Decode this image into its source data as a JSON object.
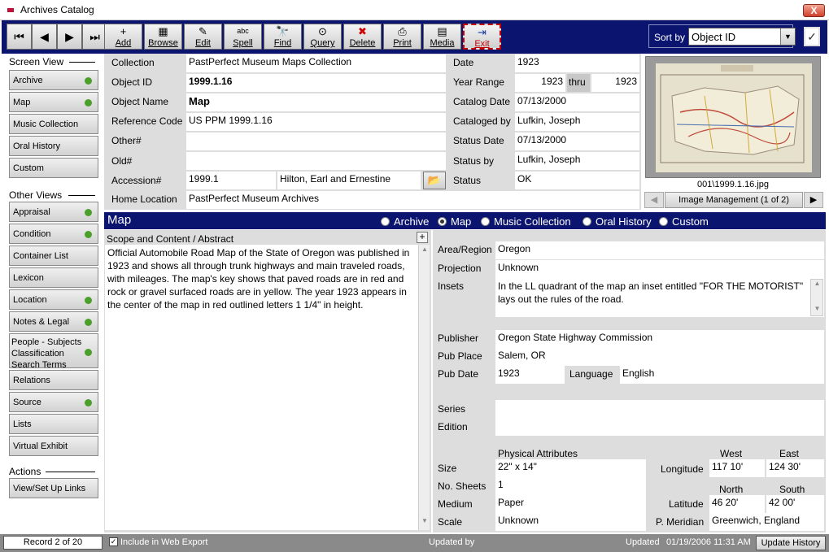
{
  "window": {
    "title": "Archives Catalog",
    "close_glyph": "X"
  },
  "toolbar": {
    "nav": [
      "⏮",
      "◀",
      "▶",
      "⏭"
    ],
    "buttons": [
      {
        "label": "Add",
        "icon": "+"
      },
      {
        "label": "Browse",
        "icon": "▦"
      },
      {
        "label": "Edit",
        "icon": "✎"
      },
      {
        "label": "Spell",
        "icon": "abc"
      },
      {
        "label": "Find",
        "icon": "🔭"
      },
      {
        "label": "Query",
        "icon": "⊙"
      },
      {
        "label": "Delete",
        "icon": "✖"
      },
      {
        "label": "Print",
        "icon": "⎙"
      },
      {
        "label": "Media",
        "icon": "▤"
      },
      {
        "label": "Exit",
        "icon": "⇥"
      }
    ],
    "sort_label": "Sort by",
    "sort_value": "Object ID"
  },
  "sidebar": {
    "screen_view_title": "Screen View",
    "screen_view": [
      {
        "label": "Archive",
        "dot": true
      },
      {
        "label": "Map",
        "dot": true
      },
      {
        "label": "Music Collection",
        "dot": false
      },
      {
        "label": "Oral History",
        "dot": false
      },
      {
        "label": "Custom",
        "dot": false
      }
    ],
    "other_views_title": "Other Views",
    "other_views": [
      {
        "label": "Appraisal",
        "dot": true
      },
      {
        "label": "Condition",
        "dot": true
      },
      {
        "label": "Container List",
        "dot": false
      },
      {
        "label": "Lexicon",
        "dot": false
      },
      {
        "label": "Location",
        "dot": true
      },
      {
        "label": "Notes & Legal",
        "dot": true
      },
      {
        "label": "Relations",
        "dot": false
      },
      {
        "label": "Source",
        "dot": true
      },
      {
        "label": "Lists",
        "dot": false
      },
      {
        "label": "Virtual Exhibit",
        "dot": false
      }
    ],
    "people_item": {
      "line1": "People - Subjects",
      "line2": "Classification",
      "line3": "Search Terms",
      "dot": true
    },
    "actions_title": "Actions",
    "actions": [
      {
        "label": "View/Set Up Links"
      }
    ]
  },
  "record": {
    "collection_label": "Collection",
    "collection": "PastPerfect Museum Maps Collection",
    "object_id_label": "Object ID",
    "object_id": "1999.1.16",
    "object_name_label": "Object Name",
    "object_name": "Map",
    "reference_code_label": "Reference Code",
    "reference_code": "US PPM 1999.1.16",
    "other_label": "Other#",
    "other": "",
    "old_label": "Old#",
    "old": "",
    "accession_label": "Accession#",
    "accession": "1999.1",
    "accession_name": "Hilton, Earl and Ernestine",
    "home_location_label": "Home Location",
    "home_location": "PastPerfect Museum Archives",
    "date_label": "Date",
    "date": "1923",
    "year_range_label": "Year Range",
    "year_from": "1923",
    "thru_label": "thru",
    "year_to": "1923",
    "catalog_date_label": "Catalog Date",
    "catalog_date": "07/13/2000",
    "cataloged_by_label": "Cataloged by",
    "cataloged_by": "Lufkin, Joseph",
    "status_date_label": "Status Date",
    "status_date": "07/13/2000",
    "status_by_label": "Status by",
    "status_by": "Lufkin, Joseph",
    "status_label": "Status",
    "status": "OK"
  },
  "image": {
    "filename": "001\\1999.1.16.jpg",
    "management": "Image Management (1 of 2)"
  },
  "map_section": {
    "title": "Map",
    "radios": [
      {
        "label": "Archive",
        "selected": false
      },
      {
        "label": "Map",
        "selected": true
      },
      {
        "label": "Music Collection",
        "selected": false
      },
      {
        "label": "Oral History",
        "selected": false
      },
      {
        "label": "Custom",
        "selected": false
      }
    ],
    "scope_label": "Scope and Content / Abstract",
    "scope_text": "Official Automobile Road Map of the State of Oregon was published in 1923 and shows all through trunk highways and main traveled roads, with mileages.  The map's key shows that paved roads are in red and rock or gravel surfaced roads are in yellow.  The year 1923 appears in the center of the map in red outlined letters 1 1/4\" in height."
  },
  "map_fields": {
    "area_label": "Area/Region",
    "area": "Oregon",
    "projection_label": "Projection",
    "projection": "Unknown",
    "insets_label": "Insets",
    "insets": "In the LL quadrant of the map an inset entitled \"FOR THE MOTORIST\" lays out the rules of the road.",
    "publisher_label": "Publisher",
    "publisher": "Oregon State Highway Commission",
    "pub_place_label": "Pub Place",
    "pub_place": "Salem, OR",
    "pub_date_label": "Pub Date",
    "pub_date": "1923",
    "language_label": "Language",
    "language": "English",
    "series_label": "Series",
    "series": "",
    "edition_label": "Edition",
    "edition": "",
    "physical_label": "Physical Attributes",
    "size_label": "Size",
    "size": "22\" x 14\"",
    "sheets_label": "No. Sheets",
    "sheets": "1",
    "medium_label": "Medium",
    "medium": "Paper",
    "scale_label": "Scale",
    "scale": "Unknown",
    "west_label": "West",
    "east_label": "East",
    "longitude_label": "Longitude",
    "long_west": "117 10'",
    "long_east": "124 30'",
    "north_label": "North",
    "south_label": "South",
    "latitude_label": "Latitude",
    "lat_north": "46 20'",
    "lat_south": "42 00'",
    "meridian_label": "P. Meridian",
    "meridian": "Greenwich, England"
  },
  "statusbar": {
    "record": "Record 2 of 20",
    "web_export": "Include in Web Export",
    "updated_by_label": "Updated by",
    "updated_label": "Updated",
    "updated_value": "01/19/2006 11:31 AM",
    "update_history": "Update History"
  }
}
